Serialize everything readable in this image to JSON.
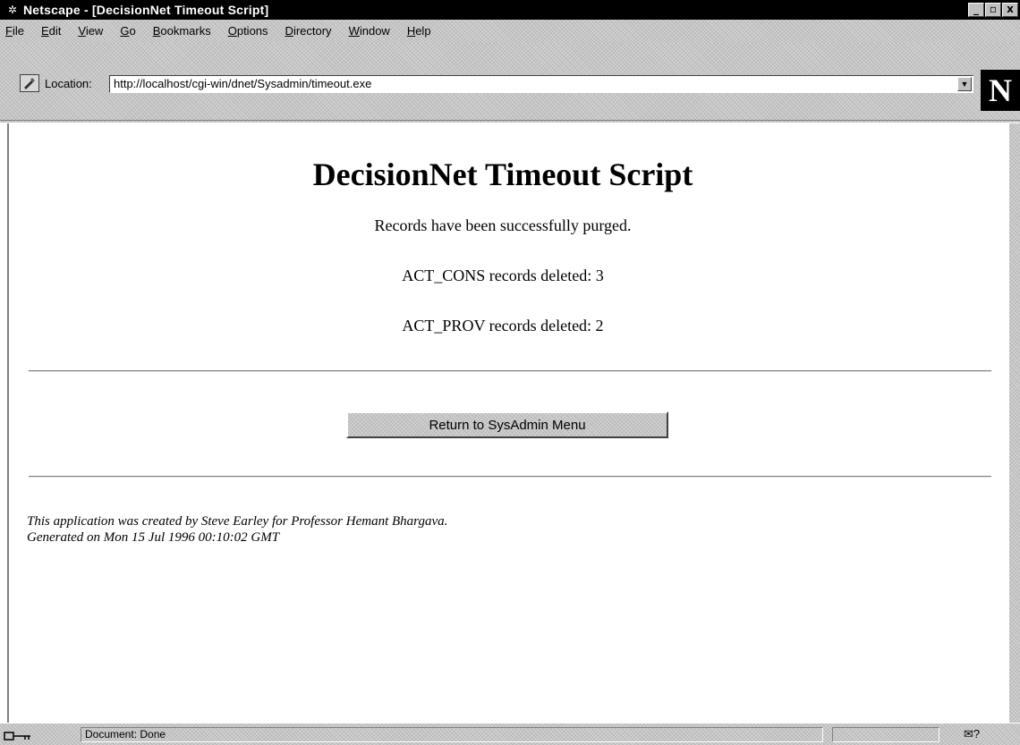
{
  "window": {
    "title": "Netscape - [DecisionNet Timeout Script]",
    "buttons": {
      "minimize": "_",
      "maximize": "▫",
      "close": "x"
    }
  },
  "menu": {
    "items": [
      "File",
      "Edit",
      "View",
      "Go",
      "Bookmarks",
      "Options",
      "Directory",
      "Window",
      "Help"
    ]
  },
  "location": {
    "label": "Location:",
    "url": "http://localhost/cgi-win/dnet/Sysadmin/timeout.exe",
    "logo": "N"
  },
  "page": {
    "title": "DecisionNet Timeout Script",
    "message": "Records have been successfully purged.",
    "act_cons": "ACT_CONS records deleted: 3",
    "act_prov": "ACT_PROV records deleted: 2",
    "return_button": "Return to SysAdmin Menu",
    "credit_line1": "This application was created by Steve Earley for Professor Hemant Bhargava.",
    "credit_line2": "Generated on Mon 15 Jul 1996 00:10:02 GMT"
  },
  "status": {
    "text": "Document: Done"
  }
}
